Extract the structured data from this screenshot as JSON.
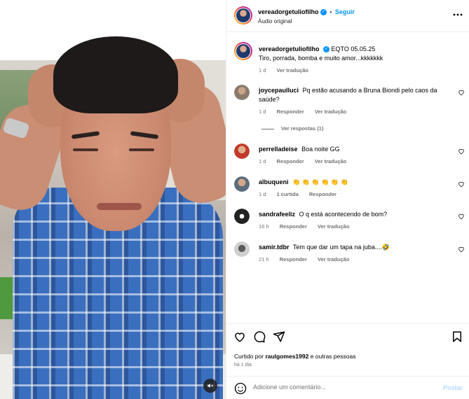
{
  "post": {
    "author": "vereadorgetuliofilho",
    "audio": "Áudio original",
    "follow_label": "Seguir",
    "more_icon": "more-horizontal-icon"
  },
  "caption": {
    "author": "vereadorgetuliofilho",
    "text": "EQTO 05.05.25",
    "text2": "Tiro, porrada, bomba e muito amor...kkkkkkk",
    "time": "1 d",
    "translate": "Ver tradução"
  },
  "comments": [
    {
      "user": "joycepaulluci",
      "text": "Pq estão acusando a Bruna Biondi pelo caos da saúde?",
      "time": "1 d",
      "reply": "Responder",
      "translate": "Ver tradução",
      "avatar_color": "#8a7a6c"
    },
    {
      "user": "perrelladeise",
      "text": "Boa noite GG",
      "time": "1 d",
      "reply": "Responder",
      "translate": "Ver tradução",
      "avatar_color": "#c0392b"
    },
    {
      "user": "albuqueni",
      "text": "👏 👏 👏 👏 👏 👏",
      "time": "1 d",
      "likes": "1 curtida",
      "reply": "Responder",
      "avatar_color": "#5b6b7a"
    },
    {
      "user": "sandrafeeliz",
      "text": "O q está acontecendo de bom?",
      "time": "16 h",
      "reply": "Responder",
      "translate": "Ver tradução",
      "avatar_color": "#222222"
    },
    {
      "user": "samir.tdbr",
      "text": "Tem que dar um tapa na juba....🤣",
      "time": "21 h",
      "reply": "Responder",
      "translate": "Ver tradução",
      "avatar_color": "#9a9a9a"
    }
  ],
  "view_replies": "Ver respostas (1)",
  "likes": {
    "prefix": "Curtido por",
    "user": "raulgomes1992",
    "suffix": "e outras pessoas"
  },
  "posted_ago": "há 1 dia",
  "comment_box": {
    "placeholder": "Adicione um comentário...",
    "post_label": "Postar"
  },
  "colors": {
    "accent": "#0095f6",
    "muted": "#737373",
    "border": "#efefef"
  }
}
